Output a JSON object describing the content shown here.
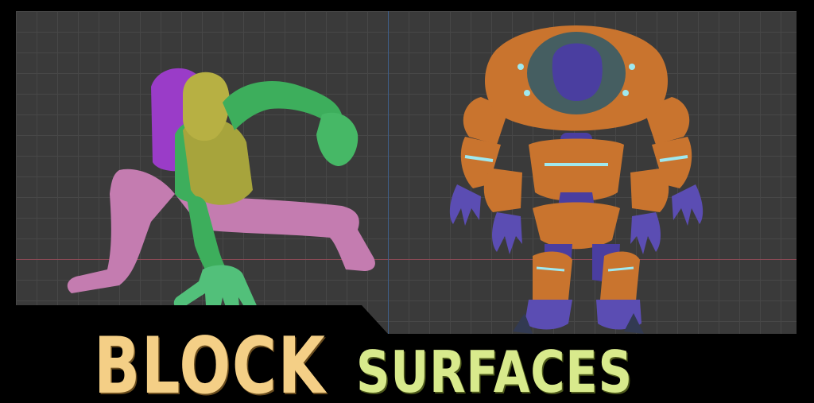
{
  "title": {
    "word1": "BLOCK",
    "word2": "SURFACES"
  },
  "colors": {
    "background": "#000000",
    "viewport_bg": "#3a3a3a",
    "grid": "#474747",
    "x_axis": "#8a4a55",
    "y_axis": "#3f5f8a",
    "title_word1": "#f4cf86",
    "title_word2": "#d8ea8c",
    "figure_green": "#3dae5c",
    "figure_pink": "#c47cb0",
    "figure_olive": "#a7a43c",
    "figure_purple": "#9a3cc8",
    "robot_orange": "#c9742e",
    "robot_purple": "#4a3ea0",
    "robot_glow": "#9fe8ef"
  }
}
